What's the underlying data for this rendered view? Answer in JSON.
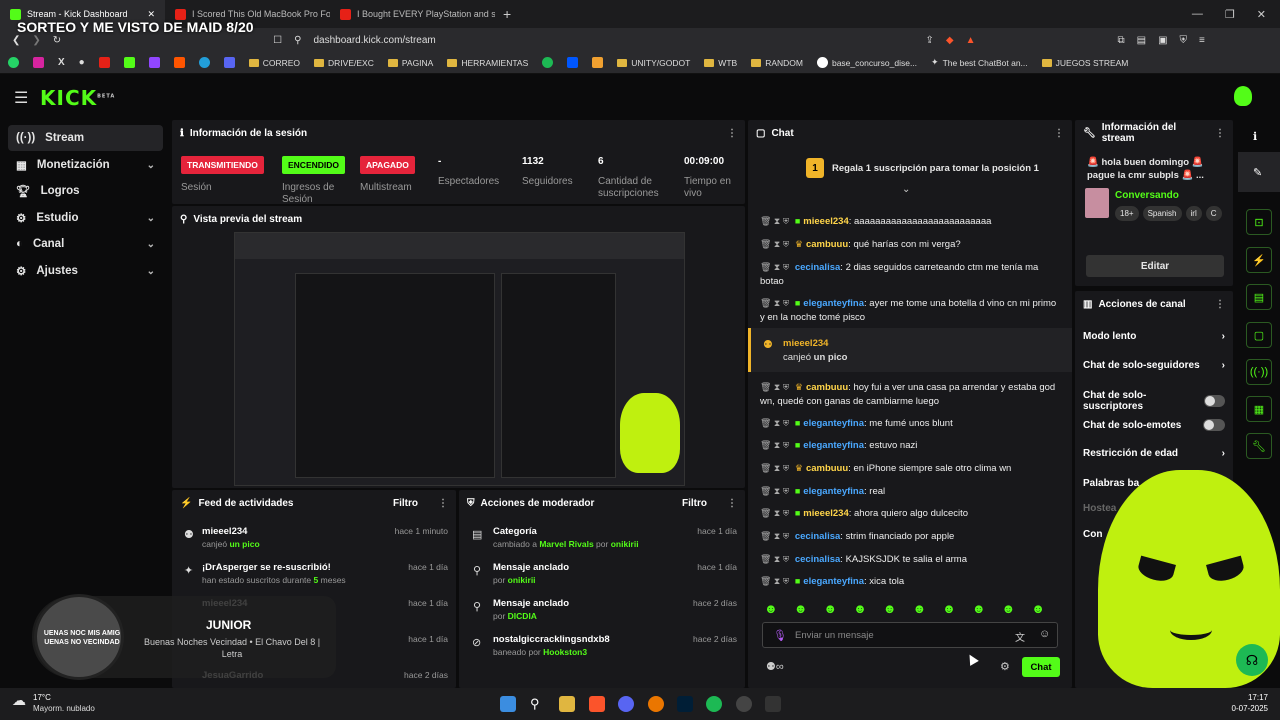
{
  "browser": {
    "tabs": [
      {
        "label": "Stream - Kick Dashboard"
      },
      {
        "label": "I Scored This Old MacBook Pro For F"
      },
      {
        "label": "I Bought EVERY PlayStation and some"
      }
    ],
    "url": "dashboard.kick.com/stream"
  },
  "bookmarks": [
    "CORREO",
    "DRIVE/EXC",
    "PAGINA",
    "HERRAMIENTAS",
    "UNITY/GODOT",
    "WTB",
    "RANDOM",
    "base_concurso_dise...",
    "The best ChatBot an...",
    "JUEGOS STREAM"
  ],
  "overlay_title": "SORTEO Y ME VISTO DE MAID 8/20",
  "logo": "KICK",
  "logo_beta": "BETA",
  "sidebar": {
    "items": [
      {
        "label": "Stream"
      },
      {
        "label": "Monetización"
      },
      {
        "label": "Logros"
      },
      {
        "label": "Estudio"
      },
      {
        "label": "Canal"
      },
      {
        "label": "Ajustes"
      }
    ]
  },
  "session": {
    "title": "Información de la sesión",
    "status": [
      {
        "badge": "TRANSMITIENDO",
        "label": "Sesión"
      },
      {
        "badge": "ENCENDIDO",
        "label": "Ingresos de Sesión"
      },
      {
        "badge": "APAGADO",
        "label": "Multistream"
      }
    ],
    "stats": [
      {
        "value": "-",
        "label": "Espectadores"
      },
      {
        "value": "1132",
        "label": "Seguidores"
      },
      {
        "value": "6",
        "label": "Cantidad de suscripciones"
      },
      {
        "value": "00:09:00",
        "label": "Tiempo en vivo"
      }
    ]
  },
  "preview": {
    "title": "Vista previa del stream"
  },
  "feed": {
    "title": "Feed de actividades",
    "filter": "Filtro",
    "items": [
      {
        "user": "mieeel234",
        "action": "canjeó",
        "extra": "un pico",
        "time": "hace 1 minuto"
      },
      {
        "user": "¡DrAsperger se re-suscribió!",
        "action": "han estado suscritos durante",
        "extra": "5",
        "extra2": "meses",
        "time": "hace 1 día"
      },
      {
        "user": "mieeel234",
        "time": "hace 1 día"
      },
      {
        "user": "",
        "time": "hace 1 día"
      },
      {
        "user": "JesuaGarrido",
        "time": "hace 2 días"
      }
    ]
  },
  "mod": {
    "title": "Acciones de moderador",
    "filter": "Filtro",
    "items": [
      {
        "title": "Categoría",
        "sub": "cambiado a",
        "extra": "Marvel Rivals",
        "by": "por",
        "who": "onikirii",
        "time": "hace 1 día"
      },
      {
        "title": "Mensaje anclado",
        "by": "por",
        "who": "onikirii",
        "time": "hace 1 día"
      },
      {
        "title": "Mensaje anclado",
        "by": "por",
        "who": "DICDIA",
        "time": "hace 2 días"
      },
      {
        "title": "nostalgiccracklingsndxb8",
        "sub": "baneado",
        "by": "por",
        "who": "Hookston3",
        "time": "hace 2 días"
      }
    ]
  },
  "chat": {
    "title": "Chat",
    "pinned": "Regala 1 suscripción para tomar la posición 1",
    "pin_rank": "1",
    "messages": [
      {
        "user": "mieeel234",
        "color": "#ffd54a",
        "text": "aaaaaaaaaaaaaaaaaaaaaaaaaa"
      },
      {
        "user": "cambuuu",
        "color": "#ffd54a",
        "text": "qué harías con mi verga?"
      },
      {
        "user": "cecinalisa",
        "color": "#4aa8ff",
        "text": "2 dias seguidos carreteando ctm me tenía ma botao"
      },
      {
        "user": "eleganteyfina",
        "color": "#4aa8ff",
        "text": "ayer me tome una botella d vino cn mi primo y en la noche tomé pisco"
      },
      {
        "user": "cambuuu",
        "color": "#ffd54a",
        "text": "hoy fui a ver una casa pa arrendar y estaba god wn, quedé con ganas de cambiarme luego"
      },
      {
        "user": "eleganteyfina",
        "color": "#4aa8ff",
        "text": "me fumé unos blunt"
      },
      {
        "user": "eleganteyfina",
        "color": "#4aa8ff",
        "text": "estuvo nazi"
      },
      {
        "user": "cambuuu",
        "color": "#ffd54a",
        "text": "en iPhone siempre sale otro clima wn"
      },
      {
        "user": "eleganteyfina",
        "color": "#4aa8ff",
        "text": "real"
      },
      {
        "user": "mieeel234",
        "color": "#ffd54a",
        "text": "ahora quiero algo dulcecito"
      },
      {
        "user": "cecinalisa",
        "color": "#4aa8ff",
        "text": "strim financiado por apple"
      },
      {
        "user": "cecinalisa",
        "color": "#4aa8ff",
        "text": "KAJSKSJDK te salia el arma"
      },
      {
        "user": "eleganteyfina",
        "color": "#4aa8ff",
        "text": "xica tola"
      }
    ],
    "redeem": {
      "user": "mieeel234",
      "action": "canjeó",
      "extra": "un pico"
    },
    "input_placeholder": "Enviar un mensaje",
    "send": "Chat"
  },
  "stream_info": {
    "title": "Información del stream",
    "stream_title": "🚨 hola buen domingo 🚨 pague la cmr subpls 🚨 ...",
    "category": "Conversando",
    "tags": [
      "18+",
      "Spanish",
      "irl",
      "C"
    ],
    "edit": "Editar"
  },
  "channel_actions": {
    "title": "Acciones de canal",
    "items": [
      {
        "label": "Modo lento"
      },
      {
        "label": "Chat de solo-seguidores"
      },
      {
        "label": "Chat de solo-suscriptores"
      },
      {
        "label": "Chat de solo-emotes"
      },
      {
        "label": "Restricción de edad"
      },
      {
        "label": "Palabras ba"
      },
      {
        "label": "Hostea"
      },
      {
        "label": "Con"
      }
    ]
  },
  "music": {
    "title": "JUNIOR",
    "subtitle": "Buenas Noches Vecindad • El Chavo Del 8 | Letra",
    "disc_text": "UENAS NOC MIS AMIG UENAS NO VECINDAD"
  },
  "taskbar": {
    "weather_temp": "17°C",
    "weather_desc": "Mayorm. nublado",
    "time": "17:17",
    "date": "0-07-2025"
  },
  "colors": {
    "accent": "#53fc18",
    "live": "#e5243b",
    "panel": "#18181b"
  }
}
